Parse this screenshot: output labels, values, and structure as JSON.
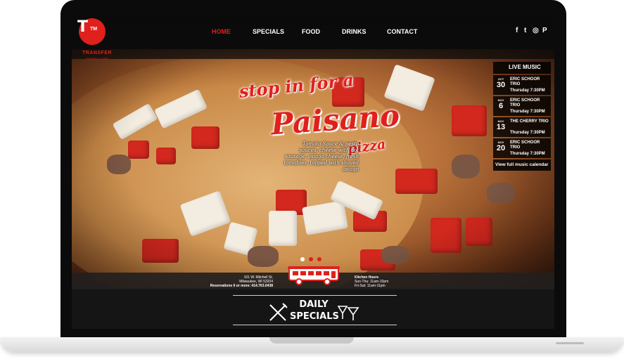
{
  "logo": {
    "mark": "T",
    "mark_suffix": "TM",
    "name": "TRANSFER",
    "subtitle": "PIZZERIA | CAFE"
  },
  "nav": {
    "items": [
      "HOME",
      "SPECIALS",
      "FOOD",
      "DRINKS",
      "CONTACT"
    ],
    "active": "HOME"
  },
  "social": {
    "icons": [
      "facebook-icon",
      "twitter-icon",
      "instagram-icon",
      "pinterest-icon"
    ],
    "glyphs": [
      "f",
      "t",
      "◎",
      "P"
    ]
  },
  "promo": {
    "line1": "stop in for a",
    "line2": "Paisano",
    "line3": "pizza",
    "description": "Tomato Sauce & pesto sauces, cheese with hot sausage, asiago cheese, fresh tomatoes, topped with shaved asiago"
  },
  "music": {
    "title": "LIVE MUSIC",
    "events": [
      {
        "month": "OCT",
        "day": "30",
        "name": "ERIC SCHOOR TRIO",
        "time": "Thursday 7:30PM"
      },
      {
        "month": "NOV",
        "day": "6",
        "name": "ERIC SCHOOR TRIO",
        "time": "Thursday 7:30PM"
      },
      {
        "month": "NOV",
        "day": "13",
        "name": "THE CHERRY TRIO",
        "time": "Thursday 7:30PM"
      },
      {
        "month": "NOV",
        "day": "20",
        "name": "ERIC SCHOOR TRIO",
        "time": "Thursday 7:30PM"
      }
    ],
    "calendar_link": "View full music calendar"
  },
  "slider": {
    "count": 3,
    "active_index": 0
  },
  "info": {
    "address_line1": "101 W. Mitchell St.",
    "address_line2": "Milwaukee, WI 53204",
    "reservations": "Reservations 6 or more: 414.763.0438",
    "hours_title": "Kitchen Hours",
    "hours_line1": "Sun-Thu: 11am-10pm",
    "hours_line2": "Fri-Sat: 11am-11pm"
  },
  "specials": {
    "line1": "DAILY",
    "line2": "SPECIALS"
  },
  "colors": {
    "accent": "#e0201c",
    "dark": "#101010"
  }
}
